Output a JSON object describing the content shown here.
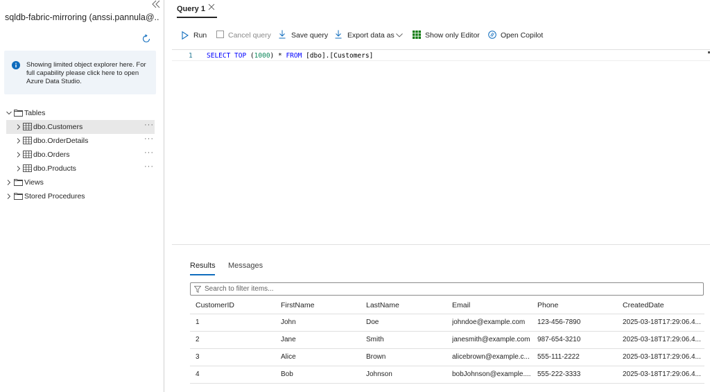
{
  "connection": {
    "title": "sqldb-fabric-mirroring (anssi.pannula@..."
  },
  "info": {
    "text": "Showing limited object explorer here. For full capability please click here to open Azure Data Studio."
  },
  "tree": {
    "tables_label": "Tables",
    "tables": [
      {
        "label": "dbo.Customers",
        "more": "···"
      },
      {
        "label": "dbo.OrderDetails",
        "more": "···"
      },
      {
        "label": "dbo.Orders",
        "more": "···"
      },
      {
        "label": "dbo.Products",
        "more": "···"
      }
    ],
    "views_label": "Views",
    "procs_label": "Stored Procedures"
  },
  "tab": {
    "label": "Query 1"
  },
  "toolbar": {
    "run": "Run",
    "cancel": "Cancel query",
    "save": "Save query",
    "export": "Export data as",
    "editor_only": "Show only Editor",
    "copilot": "Open Copilot"
  },
  "editor": {
    "line_number": "1",
    "code_parts": [
      "SELECT TOP ",
      "(",
      "1000",
      ")",
      " * ",
      "FROM ",
      "[dbo].[Customers]"
    ]
  },
  "results": {
    "tab_results": "Results",
    "tab_messages": "Messages",
    "filter_placeholder": "Search to filter items...",
    "columns": [
      "CustomerID",
      "FirstName",
      "LastName",
      "Email",
      "Phone",
      "CreatedDate"
    ],
    "rows": [
      [
        "1",
        "John",
        "Doe",
        "johndoe@example.com",
        "123-456-7890",
        "2025-03-18T17:29:06.4..."
      ],
      [
        "2",
        "Jane",
        "Smith",
        "janesmith@example.com",
        "987-654-3210",
        "2025-03-18T17:29:06.4..."
      ],
      [
        "3",
        "Alice",
        "Brown",
        "alicebrown@example.c...",
        "555-111-2222",
        "2025-03-18T17:29:06.4..."
      ],
      [
        "4",
        "Bob",
        "Johnson",
        "bobJohnson@example....",
        "555-222-3333",
        "2025-03-18T17:29:06.4..."
      ]
    ]
  },
  "colors": {
    "accent": "#0f6cbd",
    "grid_icon": "#107c10"
  }
}
